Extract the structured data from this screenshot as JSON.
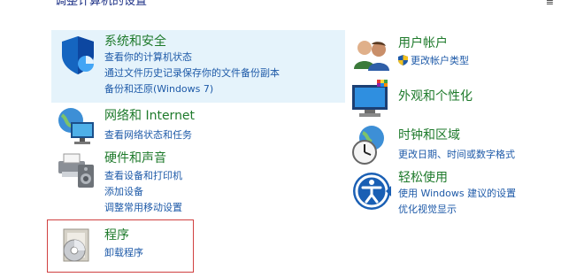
{
  "header": {
    "partial_title": "调整计算机的设置",
    "corner_mark": "≡"
  },
  "categories": {
    "system_security": {
      "title": "系统和安全",
      "links": [
        "查看你的计算机状态",
        "通过文件历史记录保存你的文件备份副本",
        "备份和还原(Windows 7)"
      ]
    },
    "network": {
      "title": "网络和 Internet",
      "links": [
        "查看网络状态和任务"
      ]
    },
    "hardware_sound": {
      "title": "硬件和声音",
      "links": [
        "查看设备和打印机",
        "添加设备",
        "调整常用移动设置"
      ]
    },
    "programs": {
      "title": "程序",
      "links": [
        "卸载程序"
      ]
    },
    "user_accounts": {
      "title": "用户帐户",
      "links": [
        "更改帐户类型"
      ]
    },
    "appearance": {
      "title": "外观和个性化",
      "links": []
    },
    "clock_region": {
      "title": "时钟和区域",
      "links": [
        "更改日期、时间或数字格式"
      ]
    },
    "ease_of_access": {
      "title": "轻松使用",
      "links": [
        "使用 Windows 建议的设置",
        "优化视觉显示"
      ]
    }
  },
  "colors": {
    "title_green": "#1e7a2b",
    "link_blue": "#1e5aa8",
    "hover_bg": "#e5f3fb",
    "focus_red": "#d04040"
  },
  "icons": {
    "system_security": "shield-icon",
    "network": "network-globe-icon",
    "hardware_sound": "printer-speaker-icon",
    "programs": "program-disc-icon",
    "user_accounts": "users-icon",
    "appearance": "monitor-palette-icon",
    "clock_region": "clock-globe-icon",
    "ease_of_access": "accessibility-icon"
  }
}
